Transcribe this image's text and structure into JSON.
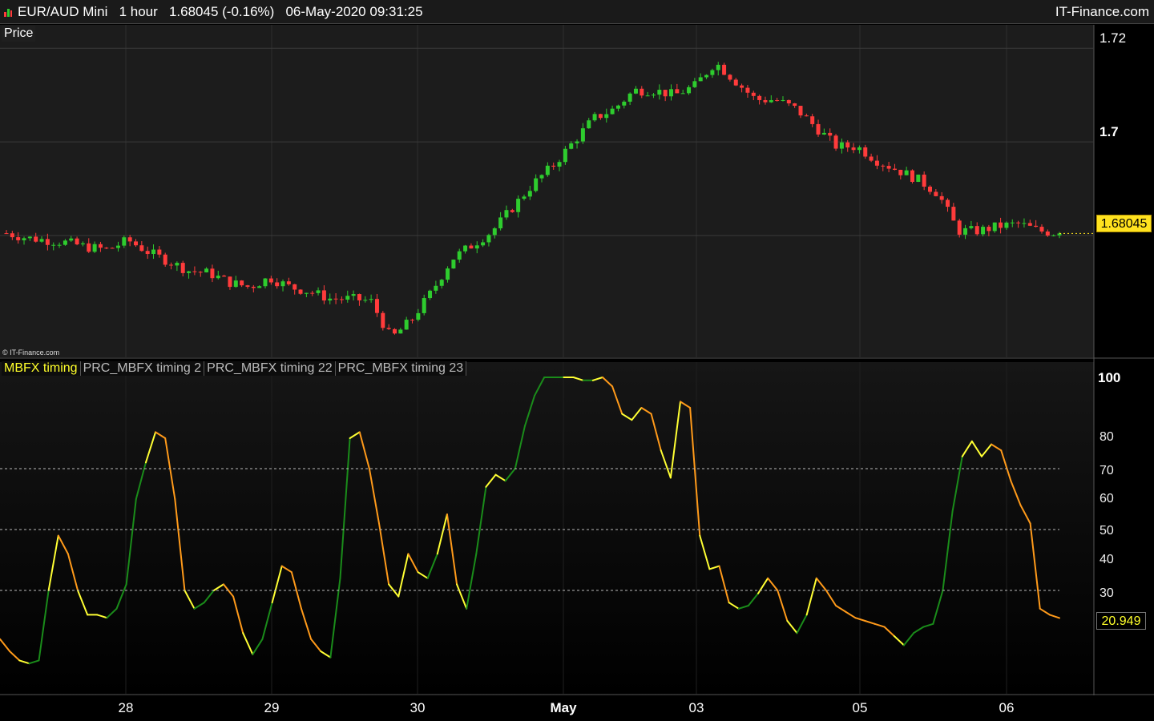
{
  "titlebar": {
    "title": "EUR/AUD Mini   1 hour   1.68045 (-0.16%)   06-May-2020 09:31:25",
    "brand": "IT-Finance.com"
  },
  "price_panel": {
    "label": "Price",
    "copyright": "© IT-Finance.com",
    "last_price": "1.68045",
    "y_ticks": [
      "1.72",
      "1.7"
    ]
  },
  "indicator_panel": {
    "tabs": [
      "MBFX timing",
      "PRC_MBFX timing 2",
      "PRC_MBFX timing 22",
      "PRC_MBFX timing 23"
    ],
    "last_value": "20.949",
    "y_ticks": [
      "100",
      "80",
      "70",
      "60",
      "50",
      "40",
      "30"
    ]
  },
  "x_axis": {
    "labels": [
      "28",
      "29",
      "30",
      "May",
      "03",
      "05",
      "06"
    ]
  },
  "colors": {
    "up": "#2ecc2e",
    "down": "#ff3b3b",
    "rising": "#1a8c1a",
    "falling": "#ff9a1a",
    "turn": "#ffff33"
  },
  "chart_data": [
    {
      "type": "candlestick",
      "title": "EUR/AUD Mini 1 hour",
      "xlabel": "",
      "ylabel": "",
      "ylim": [
        1.654,
        1.725
      ],
      "x": [
        "28",
        "29",
        "30",
        "May",
        "03",
        "05",
        "06"
      ],
      "close_path": [
        1.6805,
        1.6795,
        1.679,
        1.6785,
        1.6775,
        1.677,
        1.679,
        1.6765,
        1.6745,
        1.6725,
        1.672,
        1.67,
        1.669,
        1.671,
        1.669,
        1.668,
        1.6665,
        1.6665,
        1.666,
        1.658,
        1.662,
        1.668,
        1.675,
        1.678,
        1.681,
        1.686,
        1.691,
        1.695,
        1.7,
        1.705,
        1.707,
        1.711,
        1.711,
        1.71,
        1.712,
        1.717,
        1.713,
        1.709,
        1.709,
        1.707,
        1.703,
        1.699,
        1.699,
        1.696,
        1.694,
        1.692,
        1.689,
        1.681,
        1.681,
        1.682,
        1.6825,
        1.681,
        1.68045
      ]
    },
    {
      "type": "line",
      "title": "MBFX timing",
      "xlabel": "",
      "ylabel": "",
      "ylim": [
        0,
        100
      ],
      "hlines": [
        70,
        50,
        30
      ],
      "values": [
        14,
        10,
        7,
        6,
        7,
        30,
        48,
        42,
        30,
        22,
        22,
        21,
        24,
        32,
        60,
        72,
        82,
        80,
        60,
        30,
        24,
        26,
        30,
        32,
        28,
        16,
        9,
        14,
        26,
        38,
        36,
        24,
        14,
        10,
        8,
        34,
        80,
        82,
        70,
        52,
        32,
        28,
        42,
        36,
        34,
        42,
        55,
        32,
        24,
        42,
        64,
        68,
        66,
        70,
        84,
        94,
        100,
        100,
        100,
        100,
        99,
        99,
        100,
        97,
        88,
        86,
        90,
        88,
        76,
        67,
        92,
        90,
        48,
        37,
        38,
        26,
        24,
        25,
        29,
        34,
        30,
        20,
        16,
        22,
        34,
        30,
        25,
        23,
        21,
        20,
        19,
        18,
        15,
        12,
        16,
        18,
        19,
        30,
        56,
        74,
        79,
        74,
        78,
        76,
        66,
        58,
        52,
        24,
        22,
        20.949
      ]
    }
  ]
}
